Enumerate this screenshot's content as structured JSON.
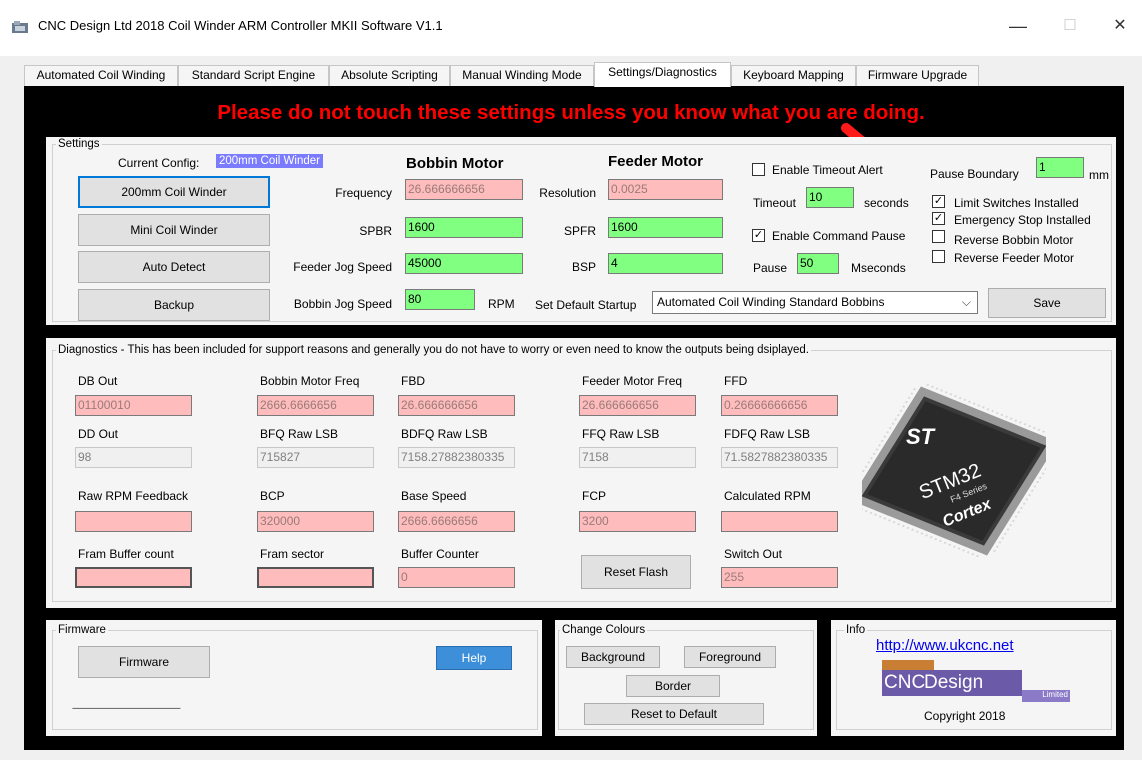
{
  "window": {
    "title": "CNC Design Ltd 2018 Coil Winder ARM Controller MKII Software V1.1",
    "minimize": "—",
    "maximize": "☐",
    "close": "✕"
  },
  "tabs": [
    "Automated Coil Winding",
    "Standard Script Engine",
    "Absolute Scripting",
    "Manual Winding Mode",
    "Settings/Diagnostics",
    "Keyboard Mapping",
    "Firmware Upgrade"
  ],
  "warning": "Please do not touch these settings unless you know what you are doing.",
  "colors": {
    "warning": "#ff0000",
    "field_pink": "#ffbcbc",
    "field_green": "#80ff80",
    "config_badge": "#7b7bff",
    "help_button": "#3c8fd8"
  },
  "settings": {
    "group_label": "Settings",
    "current_config_label": "Current Config:",
    "current_config_value": "200mm Coil Winder",
    "buttons": {
      "coil200": "200mm Coil Winder",
      "mini": "Mini Coil Winder",
      "auto": "Auto Detect",
      "backup": "Backup",
      "save": "Save"
    },
    "bobbin_header": "Bobbin Motor",
    "feeder_header": "Feeder Motor",
    "frequency_label": "Frequency",
    "frequency_value": "26.666666656",
    "spbr_label": "SPBR",
    "spbr_value": "1600",
    "feeder_jog_label": "Feeder Jog Speed",
    "feeder_jog_value": "45000",
    "bobbin_jog_label": "Bobbin Jog Speed",
    "bobbin_jog_value": "80",
    "rpm_unit": "RPM",
    "resolution_label": "Resolution",
    "resolution_value": "0.0025",
    "spfr_label": "SPFR",
    "spfr_value": "1600",
    "bsp_label": "BSP",
    "bsp_value": "4",
    "default_startup_label": "Set Default Startup",
    "default_startup_value": "Automated Coil Winding Standard Bobbins",
    "timeout_alert_label": "Enable Timeout Alert",
    "timeout_label": "Timeout",
    "timeout_value": "10",
    "timeout_unit": "seconds",
    "command_pause_label": "Enable Command Pause",
    "pause_label": "Pause",
    "pause_value": "50",
    "pause_unit": "Mseconds",
    "pause_boundary_label": "Pause Boundary",
    "pause_boundary_value": "1",
    "pause_boundary_unit": "mm",
    "limit_switches_label": "Limit Switches Installed",
    "estop_label": "Emergency Stop Installed",
    "reverse_bobbin_label": "Reverse Bobbin Motor",
    "reverse_feeder_label": "Reverse Feeder Motor",
    "checks": {
      "timeout_alert": false,
      "command_pause": true,
      "limit_switches": true,
      "estop": true,
      "reverse_bobbin": false,
      "reverse_feeder": false
    }
  },
  "diagnostics": {
    "group_label": "Diagnostics -  This has been included for support reasons and generally you do not have to worry or even need to know the outputs being dsiplayed.",
    "db_out_label": "DB Out",
    "db_out_value": "01100010",
    "bobbin_freq_label": "Bobbin Motor Freq",
    "bobbin_freq_value": "2666.6666656",
    "fbd_label": "FBD",
    "fbd_value": "26.666666656",
    "feeder_freq_label": "Feeder Motor Freq",
    "feeder_freq_value": "26.666666656",
    "ffd_label": "FFD",
    "ffd_value": "0.26666666656",
    "dd_out_label": "DD Out",
    "dd_out_value": "98",
    "bfq_label": "BFQ Raw LSB",
    "bfq_value": "715827",
    "bdfq_label": "BDFQ Raw LSB",
    "bdfq_value": "7158.27882380335",
    "ffq_label": "FFQ Raw LSB",
    "ffq_value": "7158",
    "fdfq_label": "FDFQ Raw LSB",
    "fdfq_value": "71.5827882380335",
    "raw_rpm_label": "Raw RPM Feedback",
    "raw_rpm_value": "",
    "bcp_label": "BCP",
    "bcp_value": "320000",
    "base_speed_label": "Base Speed",
    "base_speed_value": "2666.6666656",
    "fcp_label": "FCP",
    "fcp_value": "3200",
    "calc_rpm_label": "Calculated RPM",
    "calc_rpm_value": "",
    "fram_count_label": "Fram Buffer count",
    "fram_count_value": "",
    "fram_sector_label": "Fram sector",
    "fram_sector_value": "",
    "buffer_counter_label": "Buffer Counter",
    "buffer_counter_value": "0",
    "reset_flash": "Reset Flash",
    "switch_out_label": "Switch Out",
    "switch_out_value": "255",
    "chip_brand": "ST",
    "chip_model": "STM32",
    "chip_series": "F4 Series",
    "chip_core": "Cortex"
  },
  "firmware": {
    "group_label": "Firmware",
    "firmware_button": "Firmware",
    "help_button": "Help",
    "divider": "------------------------------------------------------"
  },
  "colours": {
    "group_label": "Change Colours",
    "background": "Background",
    "foreground": "Foreground",
    "border": "Border",
    "reset": "Reset to Default"
  },
  "info": {
    "group_label": "Info",
    "link": "http://www.ukcnc.net",
    "logo_cnc": "CNC",
    "logo_design": "Design",
    "logo_limited": "Limited",
    "copyright": "Copyright 2018"
  }
}
